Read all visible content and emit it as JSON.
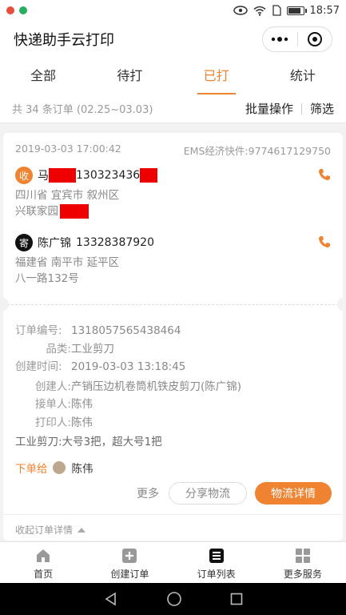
{
  "status_bar": {
    "time": "18:57",
    "battery_level": 0.85
  },
  "header": {
    "title": "快递助手云打印"
  },
  "tabs": [
    {
      "label": "全部",
      "active": false
    },
    {
      "label": "待打",
      "active": false
    },
    {
      "label": "已打",
      "active": true
    },
    {
      "label": "统计",
      "active": false
    }
  ],
  "summary": {
    "count_text": "共 34 条订单 (02.25~03.03)",
    "batch_label": "批量操作",
    "filter_label": "筛选"
  },
  "order": {
    "datetime": "2019-03-03 17:00:42",
    "carrier": "EMS经济快件:9774617129750",
    "receiver": {
      "badge": "收",
      "name": "马",
      "phone": "130323436",
      "address_line1": "四川省 宜宾市 叙州区",
      "address_line2": "兴联家园"
    },
    "sender": {
      "badge": "寄",
      "name": "陈广锦",
      "phone": "13328387920",
      "address_line1": "福建省 南平市 延平区",
      "address_line2": "八一路132号"
    },
    "details": {
      "order_no_label": "订单编号:",
      "order_no": "1318057565438464",
      "category_label": "品类:",
      "category": "工业剪刀",
      "created_label": "创建时间:",
      "created": "2019-03-03 13:18:45",
      "creator_label": "创建人:",
      "creator": "产销压边机卷筒机铁皮剪刀(陈广锦)",
      "receiver_label": "接单人:",
      "receiver": "陈伟",
      "printer_label": "打印人:",
      "printer": "陈伟",
      "note": "工业剪刀:大号3把，超大号1把"
    },
    "assign": {
      "label": "下单给",
      "name": "陈伟"
    },
    "buttons": {
      "more": "更多",
      "share": "分享物流",
      "detail": "物流详情"
    },
    "collapse_label": "收起订单详情"
  },
  "tabbar": [
    {
      "label": "首页",
      "icon": "home-icon"
    },
    {
      "label": "创建订单",
      "icon": "add-order-icon"
    },
    {
      "label": "订单列表",
      "icon": "order-list-icon"
    },
    {
      "label": "更多服务",
      "icon": "grid-icon"
    }
  ],
  "colors": {
    "accent": "#f08332",
    "redaction": "#ee0000"
  }
}
